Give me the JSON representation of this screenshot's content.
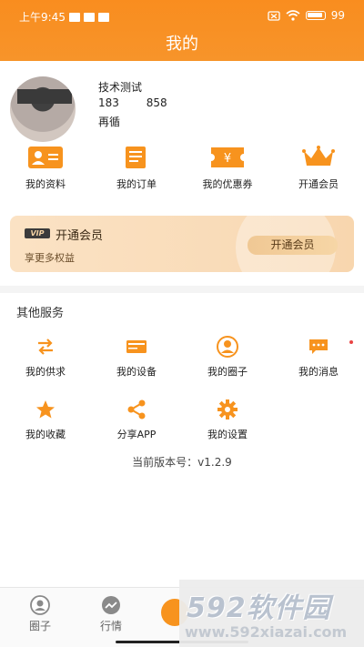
{
  "status_bar": {
    "time": "上午9:45",
    "battery": "99"
  },
  "header": {
    "title": "我的"
  },
  "profile": {
    "name": "技术测试",
    "phone": "183 858",
    "org": "再循"
  },
  "quick_actions": [
    {
      "label": "我的资料",
      "icon": "profile-card-icon"
    },
    {
      "label": "我的订单",
      "icon": "order-list-icon"
    },
    {
      "label": "我的优惠券",
      "icon": "coupon-icon"
    },
    {
      "label": "开通会员",
      "icon": "crown-icon"
    }
  ],
  "vip": {
    "badge": "VIP",
    "title": "开通会员",
    "subtitle": "享更多权益",
    "button": "开通会员"
  },
  "services": {
    "title": "其他服务",
    "items": [
      {
        "label": "我的供求",
        "icon": "swap-icon"
      },
      {
        "label": "我的设备",
        "icon": "device-icon"
      },
      {
        "label": "我的圈子",
        "icon": "user-circle-icon"
      },
      {
        "label": "我的消息",
        "icon": "message-icon"
      },
      {
        "label": "我的收藏",
        "icon": "star-icon"
      },
      {
        "label": "分享APP",
        "icon": "share-icon"
      },
      {
        "label": "我的设置",
        "icon": "gear-icon"
      }
    ],
    "version": "当前版本号：v1.2.9"
  },
  "bottom_nav": [
    {
      "label": "圈子",
      "icon": "user-circle-icon"
    },
    {
      "label": "行情",
      "icon": "trend-icon"
    }
  ],
  "watermark": {
    "brand": "592软件园",
    "url": "www.592xiazai.com"
  },
  "colors": {
    "accent": "#f7931e",
    "vip_bg": "#fbe2c4"
  }
}
